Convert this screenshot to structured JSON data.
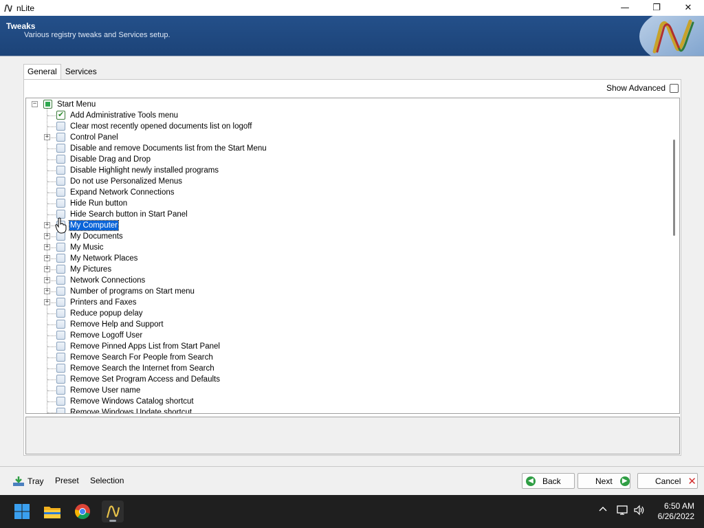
{
  "window": {
    "title": "nLite",
    "minimize_glyph": "—",
    "restore_glyph": "❐",
    "close_glyph": "✕"
  },
  "header": {
    "title": "Tweaks",
    "subtitle": "Various registry tweaks and Services setup."
  },
  "tabs": [
    {
      "label": "General",
      "active": true
    },
    {
      "label": "Services",
      "active": false
    }
  ],
  "show_advanced": {
    "label": "Show Advanced",
    "checked": false
  },
  "tree": {
    "root": {
      "label": "Start Menu",
      "state": "partial",
      "expanded": true
    },
    "items": [
      {
        "label": "Add Administrative Tools menu",
        "checked": true,
        "expandable": false,
        "selected": false
      },
      {
        "label": "Clear most recently opened documents list on logoff",
        "checked": false,
        "expandable": false,
        "selected": false
      },
      {
        "label": "Control Panel",
        "checked": false,
        "expandable": true,
        "selected": false
      },
      {
        "label": "Disable and remove Documents list from the Start Menu",
        "checked": false,
        "expandable": false,
        "selected": false
      },
      {
        "label": "Disable Drag and Drop",
        "checked": false,
        "expandable": false,
        "selected": false
      },
      {
        "label": "Disable Highlight newly installed programs",
        "checked": false,
        "expandable": false,
        "selected": false
      },
      {
        "label": "Do not use Personalized Menus",
        "checked": false,
        "expandable": false,
        "selected": false
      },
      {
        "label": "Expand Network Connections",
        "checked": false,
        "expandable": false,
        "selected": false
      },
      {
        "label": "Hide Run button",
        "checked": false,
        "expandable": false,
        "selected": false
      },
      {
        "label": "Hide Search button in Start Panel",
        "checked": false,
        "expandable": false,
        "selected": false
      },
      {
        "label": "My Computer",
        "checked": false,
        "expandable": true,
        "selected": true
      },
      {
        "label": "My Documents",
        "checked": false,
        "expandable": true,
        "selected": false
      },
      {
        "label": "My Music",
        "checked": false,
        "expandable": true,
        "selected": false
      },
      {
        "label": "My Network Places",
        "checked": false,
        "expandable": true,
        "selected": false
      },
      {
        "label": "My Pictures",
        "checked": false,
        "expandable": true,
        "selected": false
      },
      {
        "label": "Network Connections",
        "checked": false,
        "expandable": true,
        "selected": false
      },
      {
        "label": "Number of programs on Start menu",
        "checked": false,
        "expandable": true,
        "selected": false
      },
      {
        "label": "Printers and Faxes",
        "checked": false,
        "expandable": true,
        "selected": false
      },
      {
        "label": "Reduce popup delay",
        "checked": false,
        "expandable": false,
        "selected": false
      },
      {
        "label": "Remove Help and Support",
        "checked": false,
        "expandable": false,
        "selected": false
      },
      {
        "label": "Remove Logoff User",
        "checked": false,
        "expandable": false,
        "selected": false
      },
      {
        "label": "Remove Pinned Apps List from Start Panel",
        "checked": false,
        "expandable": false,
        "selected": false
      },
      {
        "label": "Remove Search For People from Search",
        "checked": false,
        "expandable": false,
        "selected": false
      },
      {
        "label": "Remove Search the Internet from Search",
        "checked": false,
        "expandable": false,
        "selected": false
      },
      {
        "label": "Remove Set Program Access and Defaults",
        "checked": false,
        "expandable": false,
        "selected": false
      },
      {
        "label": "Remove User name",
        "checked": false,
        "expandable": false,
        "selected": false
      },
      {
        "label": "Remove Windows Catalog shortcut",
        "checked": false,
        "expandable": false,
        "selected": false
      },
      {
        "label": "Remove Windows Update shortcut",
        "checked": false,
        "expandable": false,
        "selected": false
      }
    ]
  },
  "bottom": {
    "tray_label": "Tray",
    "preset_label": "Preset",
    "selection_label": "Selection",
    "back_label": "Back",
    "next_label": "Next",
    "cancel_label": "Cancel"
  },
  "taskbar": {
    "time": "6:50 AM",
    "date": "6/26/2022",
    "tray_chevron": "^"
  },
  "colors": {
    "banner": "#1c4378",
    "selection": "#0a64d8",
    "back_icon": "#2f9e44",
    "cancel_icon": "#d32f2f"
  }
}
